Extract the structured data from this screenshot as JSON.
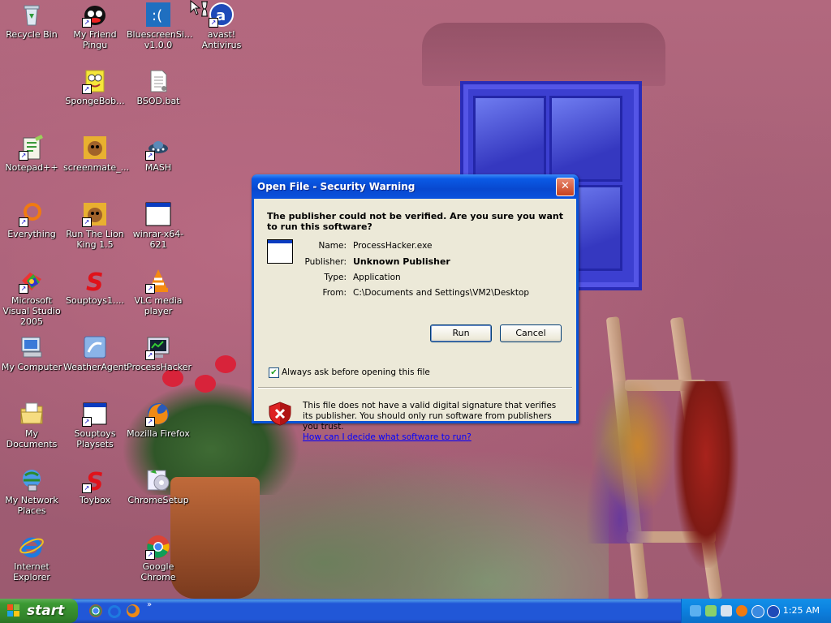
{
  "desktop": {
    "icons": [
      {
        "label": "Recycle Bin",
        "icon": "recycle-bin-icon"
      },
      {
        "label": "My Friend Pingu",
        "icon": "pingu-icon"
      },
      {
        "label": "BluescreenSi... v1.0.0",
        "icon": "bluescreen-icon"
      },
      {
        "label": "avast! Antivirus",
        "icon": "avast-icon"
      },
      {
        "label": "SpongeBob...",
        "icon": "spongebob-icon"
      },
      {
        "label": "BSOD.bat",
        "icon": "batch-file-icon"
      },
      {
        "label": "Notepad++",
        "icon": "notepad-plus-plus-icon"
      },
      {
        "label": "screenmate_...",
        "icon": "screenmate-icon"
      },
      {
        "label": "MASH",
        "icon": "mash-icon"
      },
      {
        "label": "Everything",
        "icon": "everything-search-icon"
      },
      {
        "label": "Run The Lion King 1.5",
        "icon": "lion-king-icon"
      },
      {
        "label": "winrar-x64-621",
        "icon": "installer-window-icon"
      },
      {
        "label": "Microsoft Visual Studio 2005",
        "icon": "visual-studio-icon"
      },
      {
        "label": "Souptoys1....",
        "icon": "souptoys-icon"
      },
      {
        "label": "VLC media player",
        "icon": "vlc-icon"
      },
      {
        "label": "My Computer",
        "icon": "my-computer-icon"
      },
      {
        "label": "WeatherAgent",
        "icon": "weather-agent-icon"
      },
      {
        "label": "ProcessHacker",
        "icon": "process-hacker-icon"
      },
      {
        "label": "My Documents",
        "icon": "my-documents-icon"
      },
      {
        "label": "Souptoys Playsets",
        "icon": "window-app-icon"
      },
      {
        "label": "Mozilla Firefox",
        "icon": "firefox-icon"
      },
      {
        "label": "My Network Places",
        "icon": "network-places-icon"
      },
      {
        "label": "Toybox",
        "icon": "toybox-icon"
      },
      {
        "label": "ChromeSetup",
        "icon": "chrome-setup-icon"
      },
      {
        "label": "Internet Explorer",
        "icon": "internet-explorer-icon"
      },
      {
        "label": "Google Chrome",
        "icon": "chrome-icon"
      }
    ]
  },
  "dialog": {
    "title": "Open File - Security Warning",
    "close_label": "✕",
    "question": "The publisher could not be verified.  Are you sure you want to run this software?",
    "fields": {
      "name_key": "Name:",
      "name_value": "ProcessHacker.exe",
      "publisher_key": "Publisher:",
      "publisher_value": "Unknown Publisher",
      "type_key": "Type:",
      "type_value": "Application",
      "from_key": "From:",
      "from_value": "C:\\Documents and Settings\\VM2\\Desktop"
    },
    "run_label": "Run",
    "cancel_label": "Cancel",
    "always_ask_label": "Always ask before opening this file",
    "always_ask_checked": true,
    "warning_text": "This file does not have a valid digital signature that verifies its publisher.  You should only run software from publishers you trust.",
    "help_link": "How can I decide what software to run?"
  },
  "taskbar": {
    "start_label": "start",
    "quick_launch": [
      "chrome-icon",
      "internet-explorer-icon",
      "firefox-icon"
    ],
    "more_label": "»",
    "tray_icons": [
      "network-icon",
      "safely-remove-icon",
      "volume-icon",
      "search-icon",
      "info-icon",
      "avast-icon"
    ],
    "clock": "1:25 AM"
  },
  "colors": {
    "xp_blue": "#0a53d6",
    "start_green": "#3c9a33",
    "dialog_face": "#ece9d8",
    "link": "#0000ff"
  }
}
